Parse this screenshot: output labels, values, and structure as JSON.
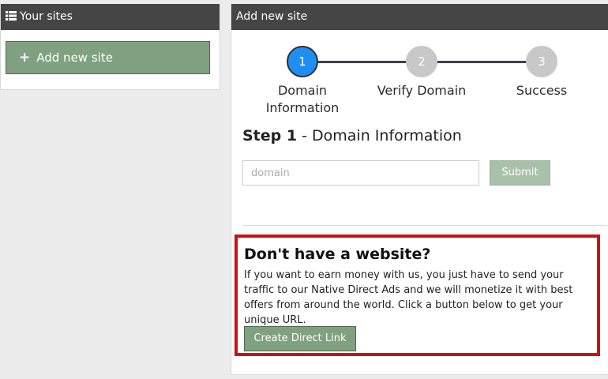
{
  "left_panel": {
    "title": "Your sites",
    "icon": "list-icon",
    "add_button_label": "Add new site"
  },
  "right_panel": {
    "title": "Add new site",
    "steps": [
      {
        "number": "1",
        "label": "Domain Information",
        "state": "active"
      },
      {
        "number": "2",
        "label": "Verify Domain",
        "state": "inactive"
      },
      {
        "number": "3",
        "label": "Success",
        "state": "inactive"
      }
    ],
    "step_heading_bold": "Step 1",
    "step_heading_rest": " - Domain Information",
    "domain_input": {
      "placeholder": "domain",
      "value": ""
    },
    "submit_label": "Submit"
  },
  "promo": {
    "title": "Don't have a website?",
    "text": "If you want to earn money with us, you just have to send your traffic to our Native Direct Ads and we will monetize it with best offers from around the world. Click a button below to get your unique URL.",
    "button_label": "Create Direct Link"
  },
  "colors": {
    "header_bg": "#454545",
    "green_button": "#7fa17f",
    "active_step": "#1f8ef2",
    "inactive_step": "#c8c8c8",
    "highlight_border": "#cc1111"
  }
}
